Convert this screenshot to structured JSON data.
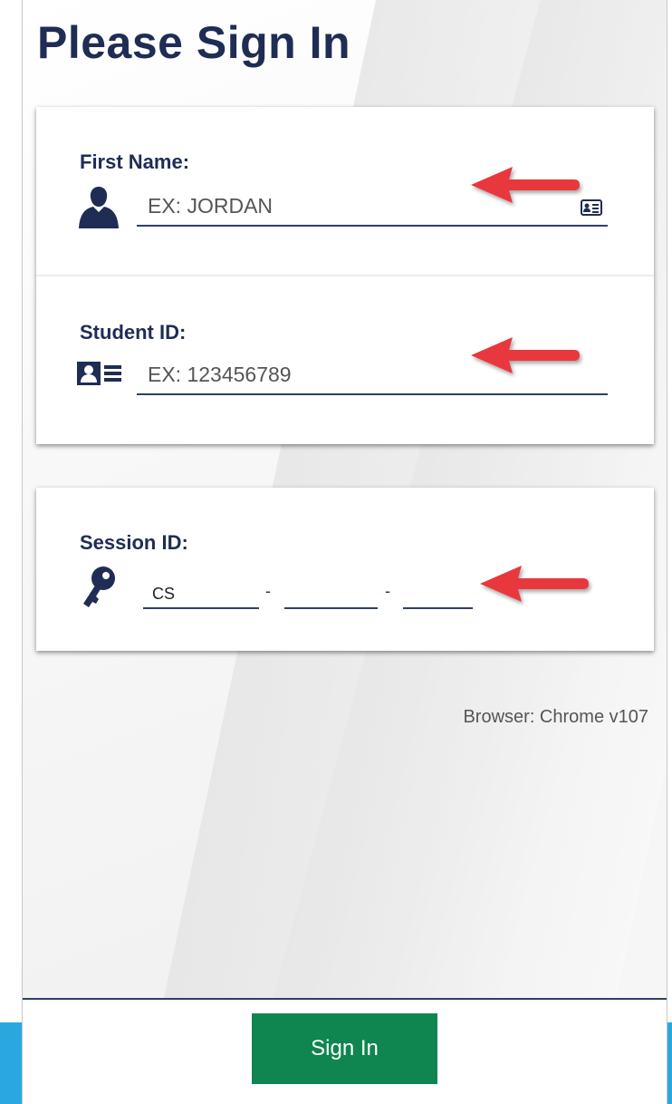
{
  "page": {
    "title": "Please Sign In",
    "browser_info": "Browser: Chrome v107"
  },
  "first_name": {
    "label": "First Name:",
    "placeholder": "EX: JORDAN",
    "icon": "person-icon",
    "trailing_icon": "contact-card-icon"
  },
  "student_id": {
    "label": "Student ID:",
    "placeholder": "EX: 123456789",
    "icon": "id-card-icon"
  },
  "session_id": {
    "label": "Session ID:",
    "icon": "key-icon",
    "part1_value": "CS",
    "part2_value": "",
    "part3_value": "",
    "separator": "-"
  },
  "footer": {
    "signin_label": "Sign In"
  },
  "colors": {
    "navy": "#1f2d55",
    "button_green": "#0f8550",
    "arrow_red": "#e8383d",
    "accent_blue": "#29a8e0"
  }
}
